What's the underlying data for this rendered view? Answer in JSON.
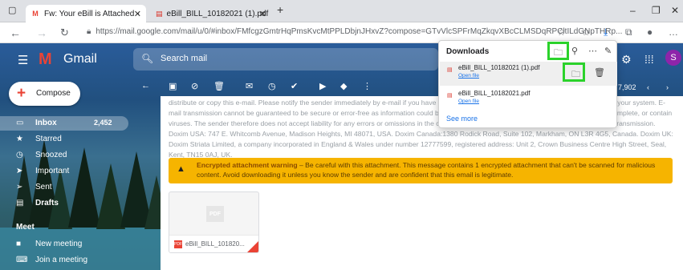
{
  "browser": {
    "tabs": [
      {
        "label": "Fw: Your eBill is Attached - durar",
        "icon": "gmail-icon",
        "active": true
      },
      {
        "label": "eBill_BILL_10182021 (1).pdf",
        "icon": "pdf-icon",
        "active": false
      }
    ],
    "new_tab": "+",
    "url": "https://mail.google.com/mail/u/0/#inbox/FMfcgzGmtrHqPmsKvcMtPPLDbjnJHxvZ?compose=GTvVlcSPFrMqZkqvXBcCLMSDqRPCltILdGNpTHRp...",
    "win_min": "–",
    "win_max": "❐",
    "win_close": "✕"
  },
  "gmail": {
    "app_name": "Gmail",
    "search_placeholder": "Search mail",
    "avatar_letter": "S",
    "compose_label": "Compose",
    "sidebar": [
      {
        "label": "Inbox",
        "count": "2,452",
        "icon": "inbox-icon",
        "active": true
      },
      {
        "label": "Starred",
        "count": "",
        "icon": "star-icon"
      },
      {
        "label": "Snoozed",
        "count": "",
        "icon": "clock-icon"
      },
      {
        "label": "Important",
        "count": "",
        "icon": "important-icon"
      },
      {
        "label": "Sent",
        "count": "",
        "icon": "send-icon"
      },
      {
        "label": "Drafts",
        "count": "",
        "icon": "draft-icon"
      }
    ],
    "meet": {
      "heading": "Meet",
      "items": [
        {
          "label": "New meeting",
          "icon": "video-icon"
        },
        {
          "label": "Join a meeting",
          "icon": "keyboard-icon"
        }
      ]
    },
    "pager": "7,902"
  },
  "email": {
    "legal_text": "distribute or copy this e-mail. Please notify the sender immediately by e-mail if you have received this e-mail by mistake and delete this e-mail from your system. E-mail transmission cannot be guaranteed to be secure or error-free as information could be intercepted, corrupted, lost, destroyed, arrive late or incomplete, or contain viruses. The sender therefore does not accept liability for any errors or omissions in the contents of this message, which arise as a result of e-mail transmission. Doxim USA: 747 E. Whitcomb Avenue, Madison Heights, MI 48071, USA. Doxim Canada:1380 Rodick Road, Suite 102, Markham, ON L3R 4G5, Canada. Doxim UK: Doxim Striata Limited, a company incorporated in England & Wales under number 12777599, registered address: Unit 2, Crown Business Centre High Street, Seal, Kent, TN15 0AJ, UK.",
    "warning_title": "Encrypted attachment warning",
    "warning_text": " – Be careful with this attachment. This message contains 1 encrypted attachment that can't be scanned for malicious content. Avoid downloading it unless you know the sender and are confident that this email is legitimate.",
    "attachment": {
      "name": "eBill_BILL_101820...",
      "placeholder": "PDF",
      "badge": "PDF"
    }
  },
  "downloads": {
    "title": "Downloads",
    "items": [
      {
        "filename": "eBill_BILL_10182021 (1).pdf",
        "action": "Open file"
      },
      {
        "filename": "eBill_BILL_10182021.pdf",
        "action": "Open file"
      }
    ],
    "see_more": "See more",
    "highlight_color": "#2bd22b"
  }
}
